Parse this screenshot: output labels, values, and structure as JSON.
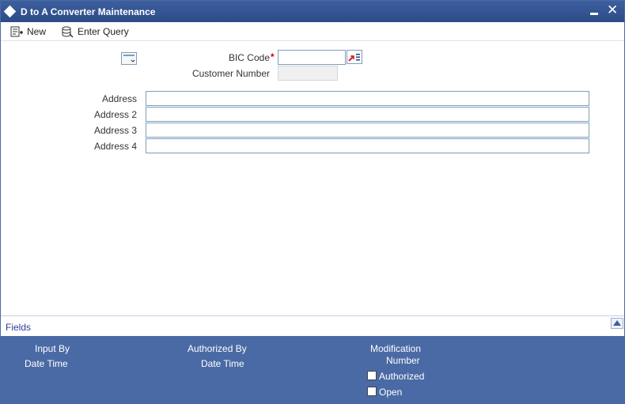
{
  "window": {
    "title": "D to A Converter Maintenance",
    "minimize_icon": "minimize-icon",
    "close_icon": "close-icon",
    "close_glyph": "✕"
  },
  "toolbar": {
    "new_label": "New",
    "enter_query_label": "Enter Query"
  },
  "form": {
    "bic_code_label": "BIC Code",
    "required_mark": "*",
    "bic_code_value": "",
    "customer_number_label": "Customer Number",
    "customer_number_value": "",
    "address_label": "Address",
    "address_2_label": "Address 2",
    "address_3_label": "Address 3",
    "address_4_label": "Address 4",
    "address_value": "",
    "address_2_value": "",
    "address_3_value": "",
    "address_4_value": ""
  },
  "fields_bar": {
    "label": "Fields"
  },
  "audit": {
    "input_by": "Input By",
    "date_time_1": "Date Time",
    "authorized_by": "Authorized By",
    "date_time_2": "Date Time",
    "modification": "Modification",
    "number": "Number",
    "authorized": "Authorized",
    "open": "Open",
    "authorized_checked": false,
    "open_checked": false
  },
  "colors": {
    "titlebar": "#2c4b88",
    "audit_panel": "#4a6aa5",
    "link": "#2a3d9a",
    "required": "#cc0000"
  }
}
